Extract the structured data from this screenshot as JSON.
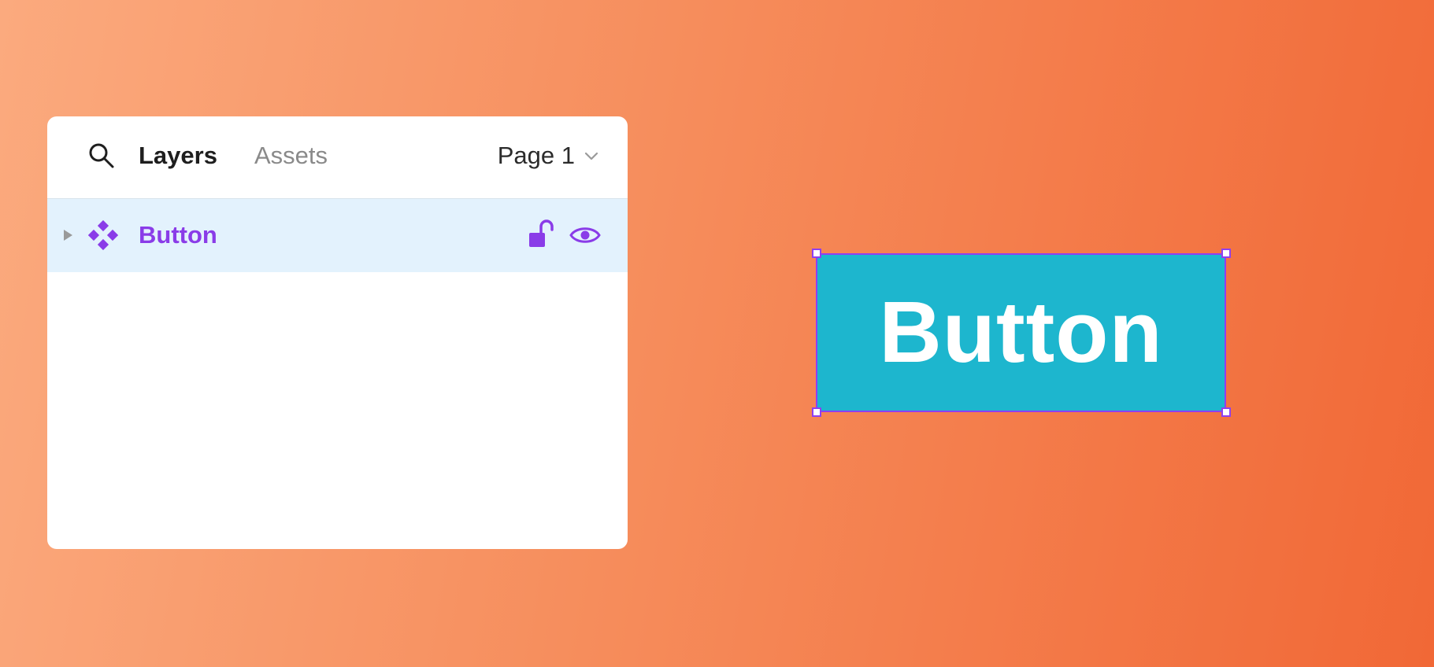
{
  "layers_panel": {
    "tabs": [
      {
        "label": "Layers",
        "active": true
      },
      {
        "label": "Assets",
        "active": false
      }
    ],
    "page_selector": {
      "label": "Page 1"
    },
    "layers": [
      {
        "name": "Button",
        "type": "component",
        "locked": false,
        "visible": true,
        "selected": true
      }
    ]
  },
  "canvas": {
    "selected_element": {
      "label": "Button",
      "fill_color": "#1db6ce",
      "selection_color": "#8f3ff0"
    }
  },
  "colors": {
    "accent": "#8a3ce8",
    "row_highlight": "#e3f2fd",
    "background_gradient": [
      "#fbaa7e",
      "#f16836"
    ]
  }
}
